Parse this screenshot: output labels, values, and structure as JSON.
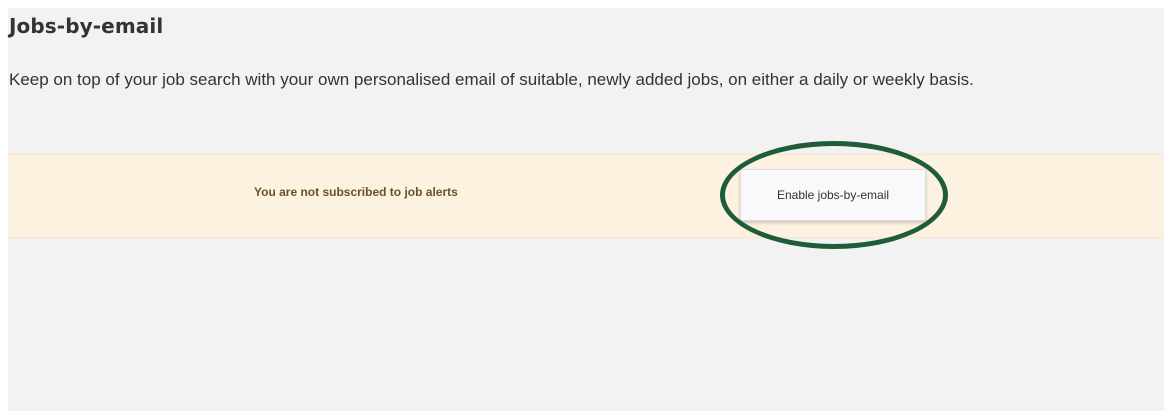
{
  "header": {
    "title": "Jobs-by-email"
  },
  "intro": {
    "text": "Keep on top of your job search with your own personalised email of suitable, newly added jobs, on either a daily or weekly basis."
  },
  "alert": {
    "status_text": "You are not subscribed to job alerts",
    "button_label": "Enable jobs-by-email"
  },
  "colors": {
    "panel_background": "#f2f2f2",
    "alert_background": "#fdf1e0",
    "status_text": "#6b5226",
    "highlight_ring": "#1f5c3a"
  }
}
